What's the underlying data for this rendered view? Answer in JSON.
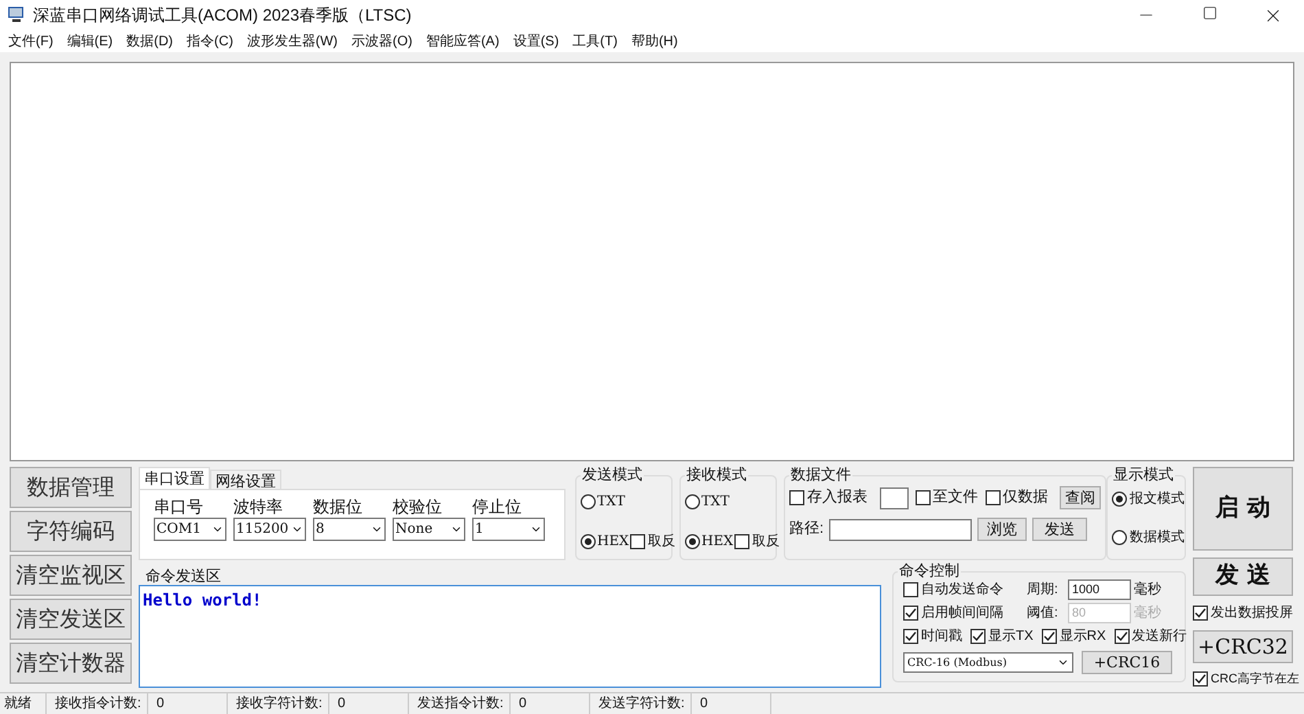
{
  "window": {
    "title": "深蓝串口网络调试工具(ACOM) 2023春季版（LTSC)"
  },
  "menu": [
    "文件(F)",
    "编辑(E)",
    "数据(D)",
    "指令(C)",
    "波形发生器(W)",
    "示波器(O)",
    "智能应答(A)",
    "设置(S)",
    "工具(T)",
    "帮助(H)"
  ],
  "side_buttons": [
    "数据管理",
    "字符编码",
    "清空监视区",
    "清空发送区",
    "清空计数器"
  ],
  "settings_tabs": [
    {
      "label": "串口设置",
      "selected": true
    },
    {
      "label": "网络设置",
      "selected": false
    }
  ],
  "port_fields": [
    {
      "label": "串口号",
      "value": "COM1"
    },
    {
      "label": "波特率",
      "value": "115200"
    },
    {
      "label": "数据位",
      "value": "8"
    },
    {
      "label": "校验位",
      "value": "None"
    },
    {
      "label": "停止位",
      "value": "1"
    }
  ],
  "send_mode": {
    "title": "发送模式",
    "options": [
      {
        "label": "TXT",
        "selected": false
      },
      {
        "label": "HEX",
        "selected": true
      }
    ],
    "invert": {
      "label": "取反",
      "checked": false
    }
  },
  "receive_mode": {
    "title": "接收模式",
    "options": [
      {
        "label": "TXT",
        "selected": false
      },
      {
        "label": "HEX",
        "selected": true
      }
    ],
    "invert": {
      "label": "取反",
      "checked": false
    }
  },
  "data_file": {
    "title": "数据文件",
    "save_report": {
      "label": "存入报表",
      "checked": false
    },
    "to_file": {
      "label": "至文件",
      "checked": false
    },
    "data_only": {
      "label": "仅数据",
      "checked": false
    },
    "query_button": "查阅",
    "path_label": "路径:",
    "browse_button": "浏览",
    "send_button": "发送"
  },
  "display_mode": {
    "title": "显示模式",
    "options": [
      {
        "label": "报文模式",
        "selected": true
      },
      {
        "label": "数据模式",
        "selected": false
      }
    ]
  },
  "start_button": "启 动",
  "command_area": {
    "label": "命令发送区",
    "value": "Hello world!"
  },
  "command_control": {
    "title": "命令控制",
    "auto_send": {
      "label": "自动发送命令",
      "checked": false
    },
    "frame_interval": {
      "label": "启用帧间间隔",
      "checked": true
    },
    "period": {
      "label": "周期:",
      "value": "1000",
      "unit": "毫秒",
      "disabled": false
    },
    "threshold": {
      "label": "阈值:",
      "value": "80",
      "unit": "毫秒",
      "disabled": true
    },
    "options": [
      {
        "label": "时间戳",
        "checked": true
      },
      {
        "label": "显示TX",
        "checked": true
      },
      {
        "label": "显示RX",
        "checked": true
      },
      {
        "label": "发送新行",
        "checked": true
      }
    ],
    "crc_select": "CRC-16 (Modbus)",
    "crc16_button": "+CRC16"
  },
  "send_button": "发 送",
  "mirror": {
    "label": "发出数据投屏",
    "checked": true
  },
  "crc32_button": "+CRC32",
  "crc_high_left": {
    "label": "CRC高字节在左",
    "checked": true
  },
  "status_bar": {
    "state": "就绪",
    "counters": [
      {
        "label": "接收指令计数:",
        "value": "0"
      },
      {
        "label": "接收字符计数:",
        "value": "0"
      },
      {
        "label": "发送指令计数:",
        "value": "0"
      },
      {
        "label": "发送字符计数:",
        "value": "0"
      }
    ]
  }
}
